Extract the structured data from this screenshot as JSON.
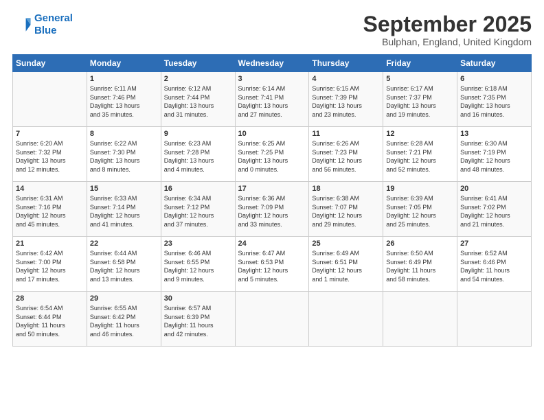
{
  "header": {
    "logo_line1": "General",
    "logo_line2": "Blue",
    "month_title": "September 2025",
    "subtitle": "Bulphan, England, United Kingdom"
  },
  "days_of_week": [
    "Sunday",
    "Monday",
    "Tuesday",
    "Wednesday",
    "Thursday",
    "Friday",
    "Saturday"
  ],
  "weeks": [
    [
      {
        "day": "",
        "content": ""
      },
      {
        "day": "1",
        "content": "Sunrise: 6:11 AM\nSunset: 7:46 PM\nDaylight: 13 hours\nand 35 minutes."
      },
      {
        "day": "2",
        "content": "Sunrise: 6:12 AM\nSunset: 7:44 PM\nDaylight: 13 hours\nand 31 minutes."
      },
      {
        "day": "3",
        "content": "Sunrise: 6:14 AM\nSunset: 7:41 PM\nDaylight: 13 hours\nand 27 minutes."
      },
      {
        "day": "4",
        "content": "Sunrise: 6:15 AM\nSunset: 7:39 PM\nDaylight: 13 hours\nand 23 minutes."
      },
      {
        "day": "5",
        "content": "Sunrise: 6:17 AM\nSunset: 7:37 PM\nDaylight: 13 hours\nand 19 minutes."
      },
      {
        "day": "6",
        "content": "Sunrise: 6:18 AM\nSunset: 7:35 PM\nDaylight: 13 hours\nand 16 minutes."
      }
    ],
    [
      {
        "day": "7",
        "content": "Sunrise: 6:20 AM\nSunset: 7:32 PM\nDaylight: 13 hours\nand 12 minutes."
      },
      {
        "day": "8",
        "content": "Sunrise: 6:22 AM\nSunset: 7:30 PM\nDaylight: 13 hours\nand 8 minutes."
      },
      {
        "day": "9",
        "content": "Sunrise: 6:23 AM\nSunset: 7:28 PM\nDaylight: 13 hours\nand 4 minutes."
      },
      {
        "day": "10",
        "content": "Sunrise: 6:25 AM\nSunset: 7:25 PM\nDaylight: 13 hours\nand 0 minutes."
      },
      {
        "day": "11",
        "content": "Sunrise: 6:26 AM\nSunset: 7:23 PM\nDaylight: 12 hours\nand 56 minutes."
      },
      {
        "day": "12",
        "content": "Sunrise: 6:28 AM\nSunset: 7:21 PM\nDaylight: 12 hours\nand 52 minutes."
      },
      {
        "day": "13",
        "content": "Sunrise: 6:30 AM\nSunset: 7:19 PM\nDaylight: 12 hours\nand 48 minutes."
      }
    ],
    [
      {
        "day": "14",
        "content": "Sunrise: 6:31 AM\nSunset: 7:16 PM\nDaylight: 12 hours\nand 45 minutes."
      },
      {
        "day": "15",
        "content": "Sunrise: 6:33 AM\nSunset: 7:14 PM\nDaylight: 12 hours\nand 41 minutes."
      },
      {
        "day": "16",
        "content": "Sunrise: 6:34 AM\nSunset: 7:12 PM\nDaylight: 12 hours\nand 37 minutes."
      },
      {
        "day": "17",
        "content": "Sunrise: 6:36 AM\nSunset: 7:09 PM\nDaylight: 12 hours\nand 33 minutes."
      },
      {
        "day": "18",
        "content": "Sunrise: 6:38 AM\nSunset: 7:07 PM\nDaylight: 12 hours\nand 29 minutes."
      },
      {
        "day": "19",
        "content": "Sunrise: 6:39 AM\nSunset: 7:05 PM\nDaylight: 12 hours\nand 25 minutes."
      },
      {
        "day": "20",
        "content": "Sunrise: 6:41 AM\nSunset: 7:02 PM\nDaylight: 12 hours\nand 21 minutes."
      }
    ],
    [
      {
        "day": "21",
        "content": "Sunrise: 6:42 AM\nSunset: 7:00 PM\nDaylight: 12 hours\nand 17 minutes."
      },
      {
        "day": "22",
        "content": "Sunrise: 6:44 AM\nSunset: 6:58 PM\nDaylight: 12 hours\nand 13 minutes."
      },
      {
        "day": "23",
        "content": "Sunrise: 6:46 AM\nSunset: 6:55 PM\nDaylight: 12 hours\nand 9 minutes."
      },
      {
        "day": "24",
        "content": "Sunrise: 6:47 AM\nSunset: 6:53 PM\nDaylight: 12 hours\nand 5 minutes."
      },
      {
        "day": "25",
        "content": "Sunrise: 6:49 AM\nSunset: 6:51 PM\nDaylight: 12 hours\nand 1 minute."
      },
      {
        "day": "26",
        "content": "Sunrise: 6:50 AM\nSunset: 6:49 PM\nDaylight: 11 hours\nand 58 minutes."
      },
      {
        "day": "27",
        "content": "Sunrise: 6:52 AM\nSunset: 6:46 PM\nDaylight: 11 hours\nand 54 minutes."
      }
    ],
    [
      {
        "day": "28",
        "content": "Sunrise: 6:54 AM\nSunset: 6:44 PM\nDaylight: 11 hours\nand 50 minutes."
      },
      {
        "day": "29",
        "content": "Sunrise: 6:55 AM\nSunset: 6:42 PM\nDaylight: 11 hours\nand 46 minutes."
      },
      {
        "day": "30",
        "content": "Sunrise: 6:57 AM\nSunset: 6:39 PM\nDaylight: 11 hours\nand 42 minutes."
      },
      {
        "day": "",
        "content": ""
      },
      {
        "day": "",
        "content": ""
      },
      {
        "day": "",
        "content": ""
      },
      {
        "day": "",
        "content": ""
      }
    ]
  ]
}
